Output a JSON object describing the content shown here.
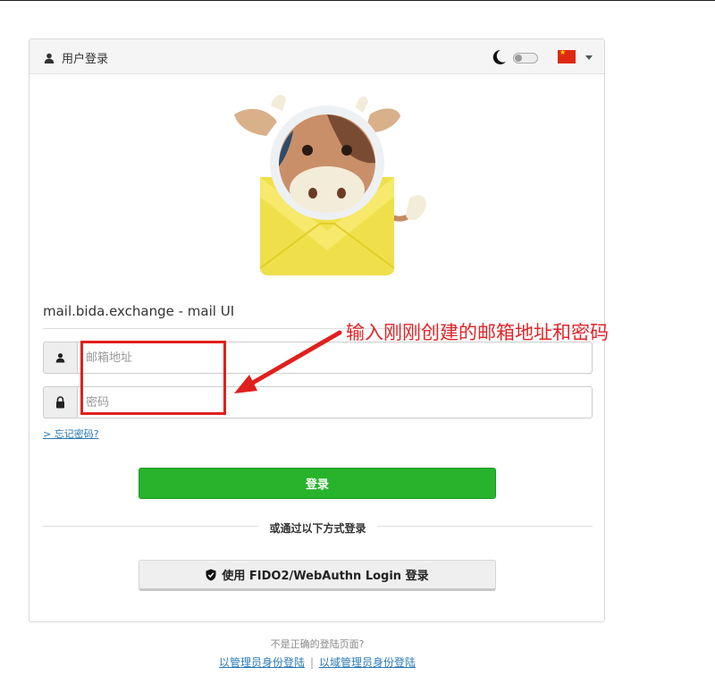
{
  "header": {
    "title": "用户登录",
    "user_icon": "user-icon",
    "theme_icon": "moon-icon",
    "language_flag": "china-flag-icon"
  },
  "logo": {
    "icon": "cow-envelope-logo"
  },
  "site_title": "mail.bida.exchange - mail UI",
  "form": {
    "email_placeholder": "邮箱地址",
    "password_placeholder": "密码",
    "forgot_password": "> 忘记密码?",
    "login_button": "登录",
    "or_text": "或通过以下方式登录",
    "fido_button": "使用 FIDO2/WebAuthn Login 登录"
  },
  "footer": {
    "question": "不是正确的登陆页面?",
    "admin_login": "以管理员身份登陆",
    "separator": "|",
    "domain_admin_login": "以域管理员身份登陆"
  },
  "annotation": {
    "text": "输入刚刚创建的邮箱地址和密码"
  },
  "colors": {
    "login_green": "#27b32b",
    "annotation_red": "#e0201e",
    "link_blue": "#2a7ab8"
  }
}
